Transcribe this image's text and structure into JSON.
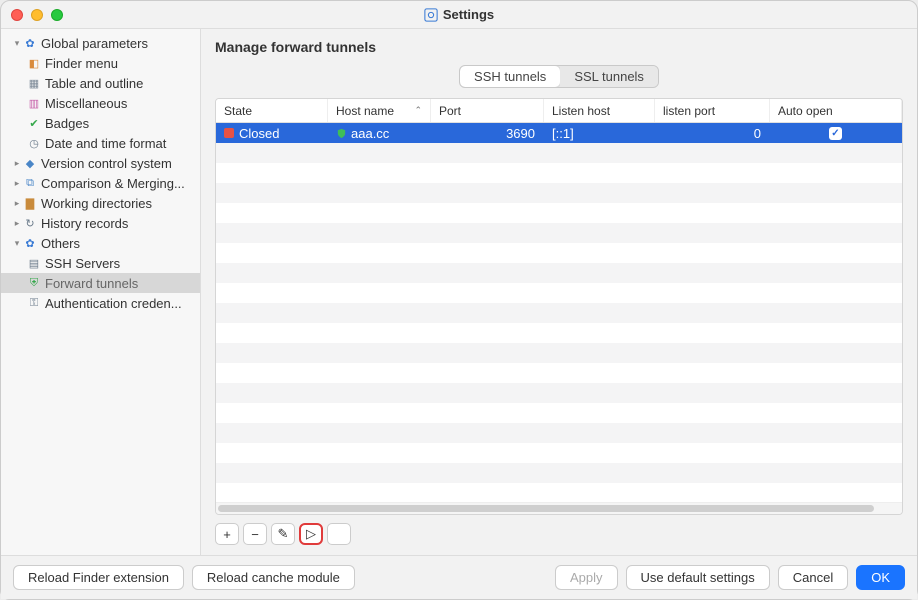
{
  "window": {
    "title": "Settings"
  },
  "sidebar": {
    "groups": [
      {
        "label": "Global parameters",
        "expanded": true,
        "icon": "gear",
        "items": [
          {
            "label": "Finder menu",
            "icon": "finder"
          },
          {
            "label": "Table and outline",
            "icon": "grid"
          },
          {
            "label": "Miscellaneous",
            "icon": "misc"
          },
          {
            "label": "Badges",
            "icon": "check"
          },
          {
            "label": "Date and time format",
            "icon": "clock"
          }
        ]
      },
      {
        "label": "Version control system",
        "expanded": false,
        "icon": "vcs"
      },
      {
        "label": "Comparison & Merging...",
        "expanded": false,
        "icon": "merge"
      },
      {
        "label": "Working directories",
        "expanded": false,
        "icon": "folder"
      },
      {
        "label": "History records",
        "expanded": false,
        "icon": "history"
      },
      {
        "label": "Others",
        "expanded": true,
        "icon": "gear",
        "items": [
          {
            "label": "SSH Servers",
            "icon": "server"
          },
          {
            "label": "Forward tunnels",
            "icon": "shield",
            "selected": true
          },
          {
            "label": "Authentication creden...",
            "icon": "key"
          }
        ]
      }
    ]
  },
  "main": {
    "title": "Manage forward tunnels",
    "tabs": {
      "active": "SSH tunnels",
      "items": [
        "SSH tunnels",
        "SSL tunnels"
      ]
    },
    "table": {
      "columns": [
        "State",
        "Host name",
        "Port",
        "Listen host",
        "listen port",
        "Auto open"
      ],
      "sort_column": "Host name",
      "rows": [
        {
          "state": "Closed",
          "host": "aaa.cc",
          "port": "3690",
          "listen_host": "[::1]",
          "listen_port": "0",
          "auto_open": true,
          "selected": true
        }
      ]
    },
    "toolbar": {
      "add": "+",
      "remove": "−",
      "edit": "✎",
      "play": "▷",
      "extra": ""
    }
  },
  "footer": {
    "reload_finder": "Reload Finder extension",
    "reload_cache": "Reload canche module",
    "apply": "Apply",
    "use_defaults": "Use default settings",
    "cancel": "Cancel",
    "ok": "OK"
  },
  "colors": {
    "selection": "#2968da",
    "closed_state": "#e75245",
    "primary": "#1a74ff"
  }
}
